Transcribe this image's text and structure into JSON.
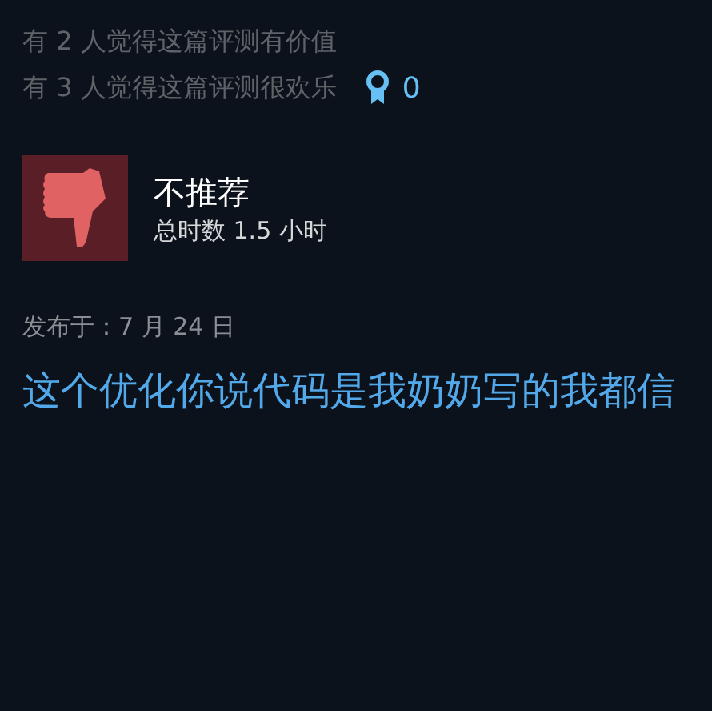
{
  "helpful_lines": [
    "有 2 人觉得这篇评测有价值",
    "有 3 人觉得这篇评测很欢乐"
  ],
  "awards": {
    "count": "0"
  },
  "review": {
    "recommended": false,
    "verdict": "不推荐",
    "playtime": "总时数 1.5 小时",
    "posted": "发布于：7 月 24 日",
    "text": "这个优化你说代码是我奶奶写的我都信"
  }
}
